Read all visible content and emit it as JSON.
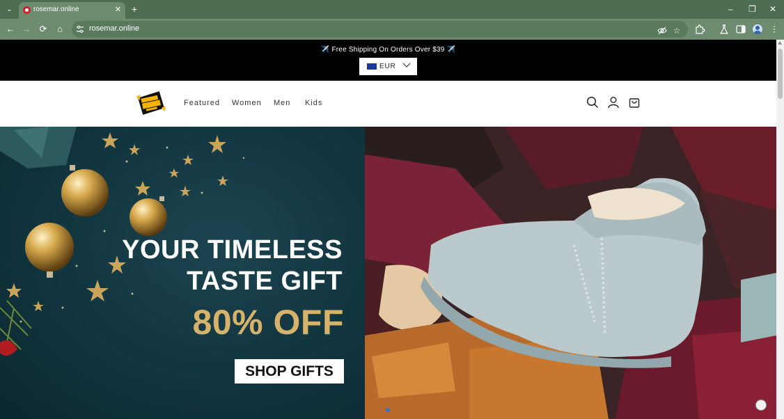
{
  "browser": {
    "tab": {
      "title": "rosemar.online"
    },
    "url": "rosemar.online"
  },
  "announcement": {
    "text": "✈️ Free Shipping On Orders Over $39 ✈️"
  },
  "currency": {
    "code": "EUR"
  },
  "logo": {
    "alt_text": "BLACK FRIDAY SUPER SALE"
  },
  "nav": {
    "items": [
      "Featured",
      "Women",
      "Men",
      "Kids"
    ]
  },
  "hero": {
    "title_line1": "YOUR TIMELESS",
    "title_line2": "TASTE GIFT",
    "discount": "80% OFF",
    "cta": "SHOP GIFTS"
  },
  "colors": {
    "browser_frame": "#4d6c52",
    "announcement_bg": "#000000",
    "hero_accent_gold": "#d6b26b",
    "hero_left_bg": "#123640"
  }
}
